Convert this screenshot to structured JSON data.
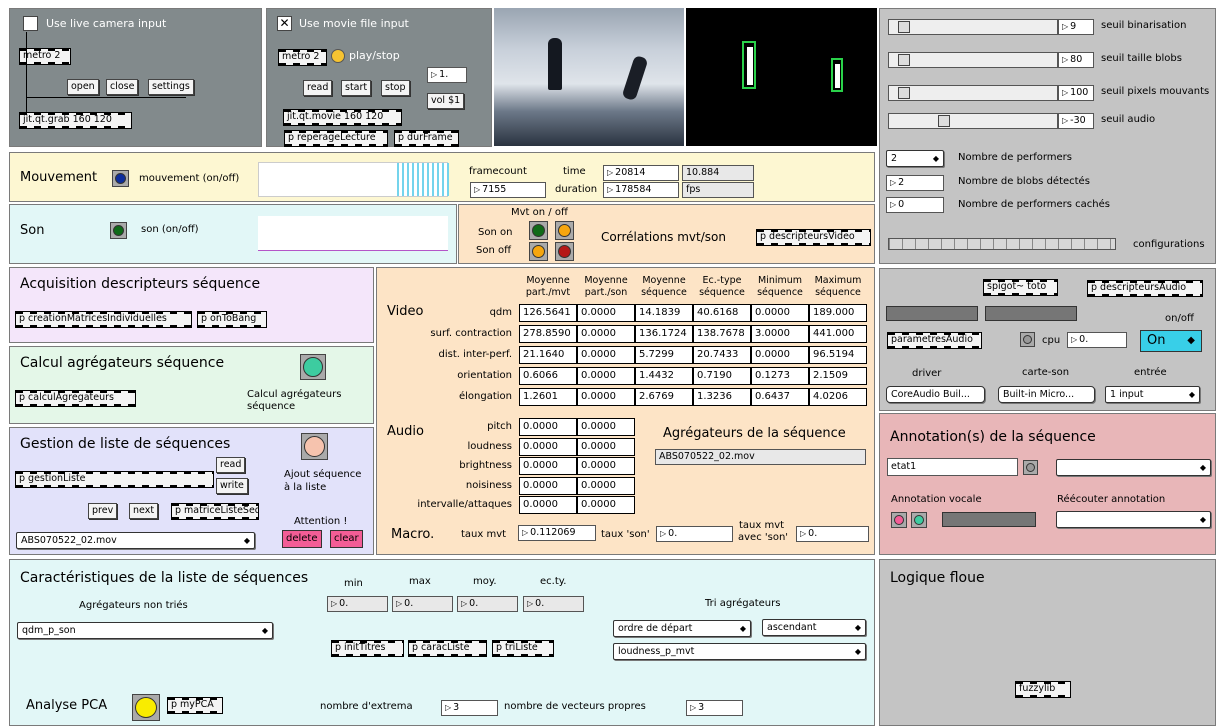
{
  "camera": {
    "toggle": "Use live camera input",
    "metro": "metro 2",
    "open": "open",
    "close": "close",
    "settings": "settings",
    "grab": "jit.qt.grab 160 120"
  },
  "movie": {
    "toggle": "Use movie file input",
    "metro": "metro 2",
    "playstop": "play/stop",
    "read": "read",
    "start": "start",
    "stop": "stop",
    "num1": "1.",
    "vol": "vol $1",
    "qtmovie": "jit.qt.movie 160 120",
    "reperage": "p reperageLecture",
    "durframe": "p durFrame"
  },
  "sliders": [
    {
      "value": "9",
      "label": "seuil binarisation",
      "fraction": 0.03
    },
    {
      "value": "80",
      "label": "seuil taille blobs",
      "fraction": 0.03
    },
    {
      "value": "100",
      "label": "seuil pixels mouvants",
      "fraction": 0.03
    },
    {
      "value": "-30",
      "label": "seuil audio",
      "fraction": 0.3
    }
  ],
  "performers": {
    "count": "2",
    "count_label": "Nombre de performers",
    "blobs": "2",
    "blobs_label": "Nombre de blobs détectés",
    "hidden": "0",
    "hidden_label": "Nombre de performers cachés",
    "configurations": "configurations"
  },
  "mouvement": {
    "title": "Mouvement",
    "toggle_label": "mouvement (on/off)",
    "framecount_label": "framecount",
    "framecount": "7155",
    "time_label": "time",
    "time": "20814",
    "duration_label": "duration",
    "duration": "178584",
    "fps_value": "10.884",
    "fps_label": "fps"
  },
  "son": {
    "title": "Son",
    "toggle_label": "son (on/off)"
  },
  "correlations": {
    "header": "Mvt on / off",
    "son_on": "Son on",
    "son_off": "Son off",
    "title": "Corrélations mvt/son",
    "descripteurs": "p descripteursVideo"
  },
  "acquisition": {
    "title": "Acquisition descripteurs séquence",
    "obj1": "p creationMatricesIndividuelles",
    "obj2": "p onToBang"
  },
  "calcul": {
    "title": "Calcul agrégateurs séquence",
    "obj": "p calculAgregateurs",
    "label": "Calcul agrégateurs séquence"
  },
  "gestion": {
    "title": "Gestion de liste de séquences",
    "obj": "p gestionListe",
    "read": "read",
    "write": "write",
    "ajout": "Ajout séquence à la liste",
    "prev": "prev",
    "next": "next",
    "matrice": "p matriceListeSeq",
    "attention": "Attention !",
    "file": "ABS070522_02.mov",
    "delete": "delete",
    "clear": "clear"
  },
  "stats": {
    "columns": [
      "Moyenne part./mvt",
      "Moyenne part./son",
      "Moyenne séquence",
      "Ec.-type séquence",
      "Minimum séquence",
      "Maximum séquence"
    ],
    "video_title": "Video",
    "video_rows": [
      {
        "label": "qdm",
        "values": [
          "126.5641",
          "0.0000",
          "14.1839",
          "40.6168",
          "0.0000",
          "189.000"
        ]
      },
      {
        "label": "surf. contraction",
        "values": [
          "278.8590",
          "0.0000",
          "136.1724",
          "138.7678",
          "3.0000",
          "441.000"
        ]
      },
      {
        "label": "dist. inter-perf.",
        "values": [
          "21.1640",
          "0.0000",
          "5.7299",
          "20.7433",
          "0.0000",
          "96.5194"
        ]
      },
      {
        "label": "orientation",
        "values": [
          "0.6066",
          "0.0000",
          "1.4432",
          "0.7190",
          "0.1273",
          "2.1509"
        ]
      },
      {
        "label": "élongation",
        "values": [
          "1.2601",
          "0.0000",
          "2.6769",
          "1.3236",
          "0.6437",
          "4.0206"
        ]
      }
    ],
    "audio_title": "Audio",
    "audio_rows": [
      {
        "label": "pitch",
        "values": [
          "0.0000",
          "0.0000"
        ]
      },
      {
        "label": "loudness",
        "values": [
          "0.0000",
          "0.0000"
        ]
      },
      {
        "label": "brightness",
        "values": [
          "0.0000",
          "0.0000"
        ]
      },
      {
        "label": "noisiness",
        "values": [
          "0.0000",
          "0.0000"
        ]
      },
      {
        "label": "intervalle/attaques",
        "values": [
          "0.0000",
          "0.0000"
        ]
      }
    ],
    "agg_title": "Agrégateurs de la séquence",
    "agg_file": "ABS070522_02.mov",
    "macro_title": "Macro.",
    "taux_mvt_label": "taux mvt",
    "taux_mvt": "0.112069",
    "taux_son_label": "taux 'son'",
    "taux_son": "0.",
    "taux_avec_label1": "taux mvt",
    "taux_avec_label2": "avec 'son'",
    "taux_avec": "0."
  },
  "audio_panel": {
    "spigot": "spigot~ toto",
    "descripteurs": "p descripteursAudio",
    "onoff": "on/off",
    "parametres": "parametresAudio",
    "cpu": "cpu",
    "cpu_value": "0.",
    "on": "On",
    "driver_label": "driver",
    "carte_label": "carte-son",
    "entree_label": "entrée",
    "driver": "CoreAudio Buil...",
    "carte": "Built-in Micro...",
    "entree": "1 input"
  },
  "annotation": {
    "title": "Annotation(s) de la séquence",
    "input": "etat1",
    "vocale": "Annotation vocale",
    "reecouter": "Réécouter annotation"
  },
  "caract": {
    "title": "Caractéristiques de la liste de séquences",
    "min": "min",
    "max": "max",
    "moy": "moy.",
    "ecty": "ec.ty.",
    "v_min": "0.",
    "v_max": "0.",
    "v_moy": "0.",
    "v_ecty": "0.",
    "agg_label": "Agrégateurs non triés",
    "agg_select": "qdm_p_son",
    "init": "p initTitres",
    "caracliste": "p caracListe",
    "triliste": "p triListe",
    "tri_label": "Tri agrégateurs",
    "ordre": "ordre de départ",
    "ascendant": "ascendant",
    "loudness": "loudness_p_mvt",
    "pca": "Analyse PCA",
    "mypca": "p myPCA",
    "extrema_label": "nombre d'extrema",
    "extrema": "3",
    "vecteurs_label": "nombre de vecteurs propres",
    "vecteurs": "3"
  },
  "logique": {
    "title": "Logique floue",
    "fuzzylib": "fuzzylib"
  },
  "colors": {
    "gray_panel": "#828a8c",
    "yellow": "#fdf7d2",
    "cyan": "#e2f7f7",
    "orange": "#fde4c6",
    "lavender": "#f4e6fa",
    "mint": "#e4f7e8",
    "periwinkle": "#e2e2fa",
    "annot": "#e8b6b8"
  }
}
